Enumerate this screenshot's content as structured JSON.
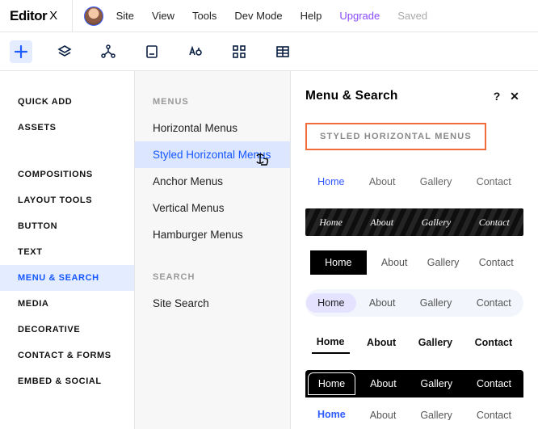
{
  "logo": {
    "main": "Editor",
    "suffix": "X"
  },
  "top_nav": [
    {
      "label": "Site"
    },
    {
      "label": "View"
    },
    {
      "label": "Tools"
    },
    {
      "label": "Dev Mode"
    },
    {
      "label": "Help"
    },
    {
      "label": "Upgrade",
      "class": "upgrade"
    },
    {
      "label": "Saved",
      "class": "saved"
    }
  ],
  "icon_strip": [
    {
      "name": "add-icon",
      "active": true
    },
    {
      "name": "layers-icon"
    },
    {
      "name": "structure-icon"
    },
    {
      "name": "page-icon"
    },
    {
      "name": "typography-icon"
    },
    {
      "name": "grid-icon"
    },
    {
      "name": "table-icon"
    }
  ],
  "sidebar": {
    "top": [
      {
        "label": "Quick Add"
      },
      {
        "label": "Assets"
      }
    ],
    "main": [
      {
        "label": "Compositions"
      },
      {
        "label": "Layout Tools"
      },
      {
        "label": "Button"
      },
      {
        "label": "Text"
      },
      {
        "label": "Menu & Search",
        "active": true
      },
      {
        "label": "Media"
      },
      {
        "label": "Decorative"
      },
      {
        "label": "Contact & Forms"
      },
      {
        "label": "Embed & Social"
      }
    ]
  },
  "subpanel": {
    "sections": [
      {
        "heading": "Menus",
        "items": [
          {
            "label": "Horizontal Menus"
          },
          {
            "label": "Styled Horizontal Menus",
            "active": true
          },
          {
            "label": "Anchor Menus"
          },
          {
            "label": "Vertical Menus"
          },
          {
            "label": "Hamburger Menus"
          }
        ]
      },
      {
        "heading": "Search",
        "items": [
          {
            "label": "Site Search"
          }
        ]
      }
    ]
  },
  "detail": {
    "title": "Menu & Search",
    "help": "?",
    "close": "✕",
    "section_label": "Styled Horizontal Menus",
    "previews": [
      {
        "variant": "pv0",
        "items": [
          "Home",
          "About",
          "Gallery",
          "Contact"
        ],
        "selected": 0
      },
      {
        "variant": "pv1",
        "items": [
          "Home",
          "About",
          "Gallery",
          "Contact"
        ],
        "selected": -1
      },
      {
        "variant": "pv2",
        "items": [
          "Home",
          "About",
          "Gallery",
          "Contact"
        ],
        "selected": 0
      },
      {
        "variant": "pv3",
        "items": [
          "Home",
          "About",
          "Gallery",
          "Contact"
        ],
        "selected": 0
      },
      {
        "variant": "pv4",
        "items": [
          "Home",
          "About",
          "Gallery",
          "Contact"
        ],
        "selected": 0
      },
      {
        "variant": "pv5",
        "items": [
          "Home",
          "About",
          "Gallery",
          "Contact"
        ],
        "selected": 0
      },
      {
        "variant": "pv6",
        "items": [
          "Home",
          "About",
          "Gallery",
          "Contact"
        ],
        "selected": 0
      }
    ]
  }
}
